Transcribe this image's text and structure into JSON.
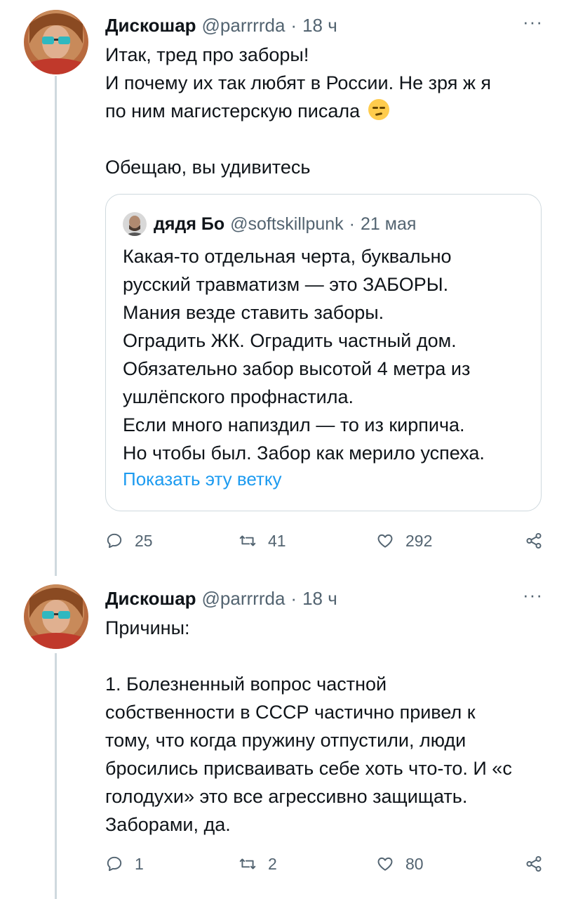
{
  "tweets": [
    {
      "author_name": "Дискошар",
      "handle": "@parrrrda",
      "separator": "·",
      "time": "18 ч",
      "more": "···",
      "text_lines": [
        "Итак, тред про заборы!",
        "И почему их так любят в России. Не зря ж я",
        "по ним магистерскую писала",
        "Обещаю, вы удивитесь"
      ],
      "emoji": "smirking-face",
      "quote": {
        "author_name": "дядя Бо",
        "handle": "@softskillpunk",
        "separator": "·",
        "date": "21 мая",
        "text_lines": [
          "Какая-то отдельная черта, буквально",
          "русский травматизм — это ЗАБОРЫ.",
          "Мания везде ставить заборы.",
          "Оградить ЖК. Оградить частный дом.",
          "Обязательно забор высотой 4 метра из",
          "ушлёпского профнастила.",
          "Если много напиздил — то из кирпича.",
          "Но чтобы был. Забор как мерило успеха."
        ],
        "show_thread": "Показать эту ветку"
      },
      "actions": {
        "replies": "25",
        "retweets": "41",
        "likes": "292"
      }
    },
    {
      "author_name": "Дискошар",
      "handle": "@parrrrda",
      "separator": "·",
      "time": "18 ч",
      "more": "···",
      "text_lines": [
        "Причины:",
        "1. Болезненный вопрос частной",
        "собственности в СССР частично привел к",
        "тому, что когда пружину отпустили, люди",
        "бросились присваивать себе хоть что-то. И «с",
        "голодухи» это все агрессивно защищать.",
        "Заборами, да."
      ],
      "actions": {
        "replies": "1",
        "retweets": "2",
        "likes": "80"
      }
    }
  ],
  "colors": {
    "text": "#0f1419",
    "secondary": "#536471",
    "link": "#1d9bf0",
    "border": "#cfd9de"
  },
  "icons": [
    "reply-icon",
    "retweet-icon",
    "like-icon",
    "share-icon",
    "more-icon"
  ]
}
